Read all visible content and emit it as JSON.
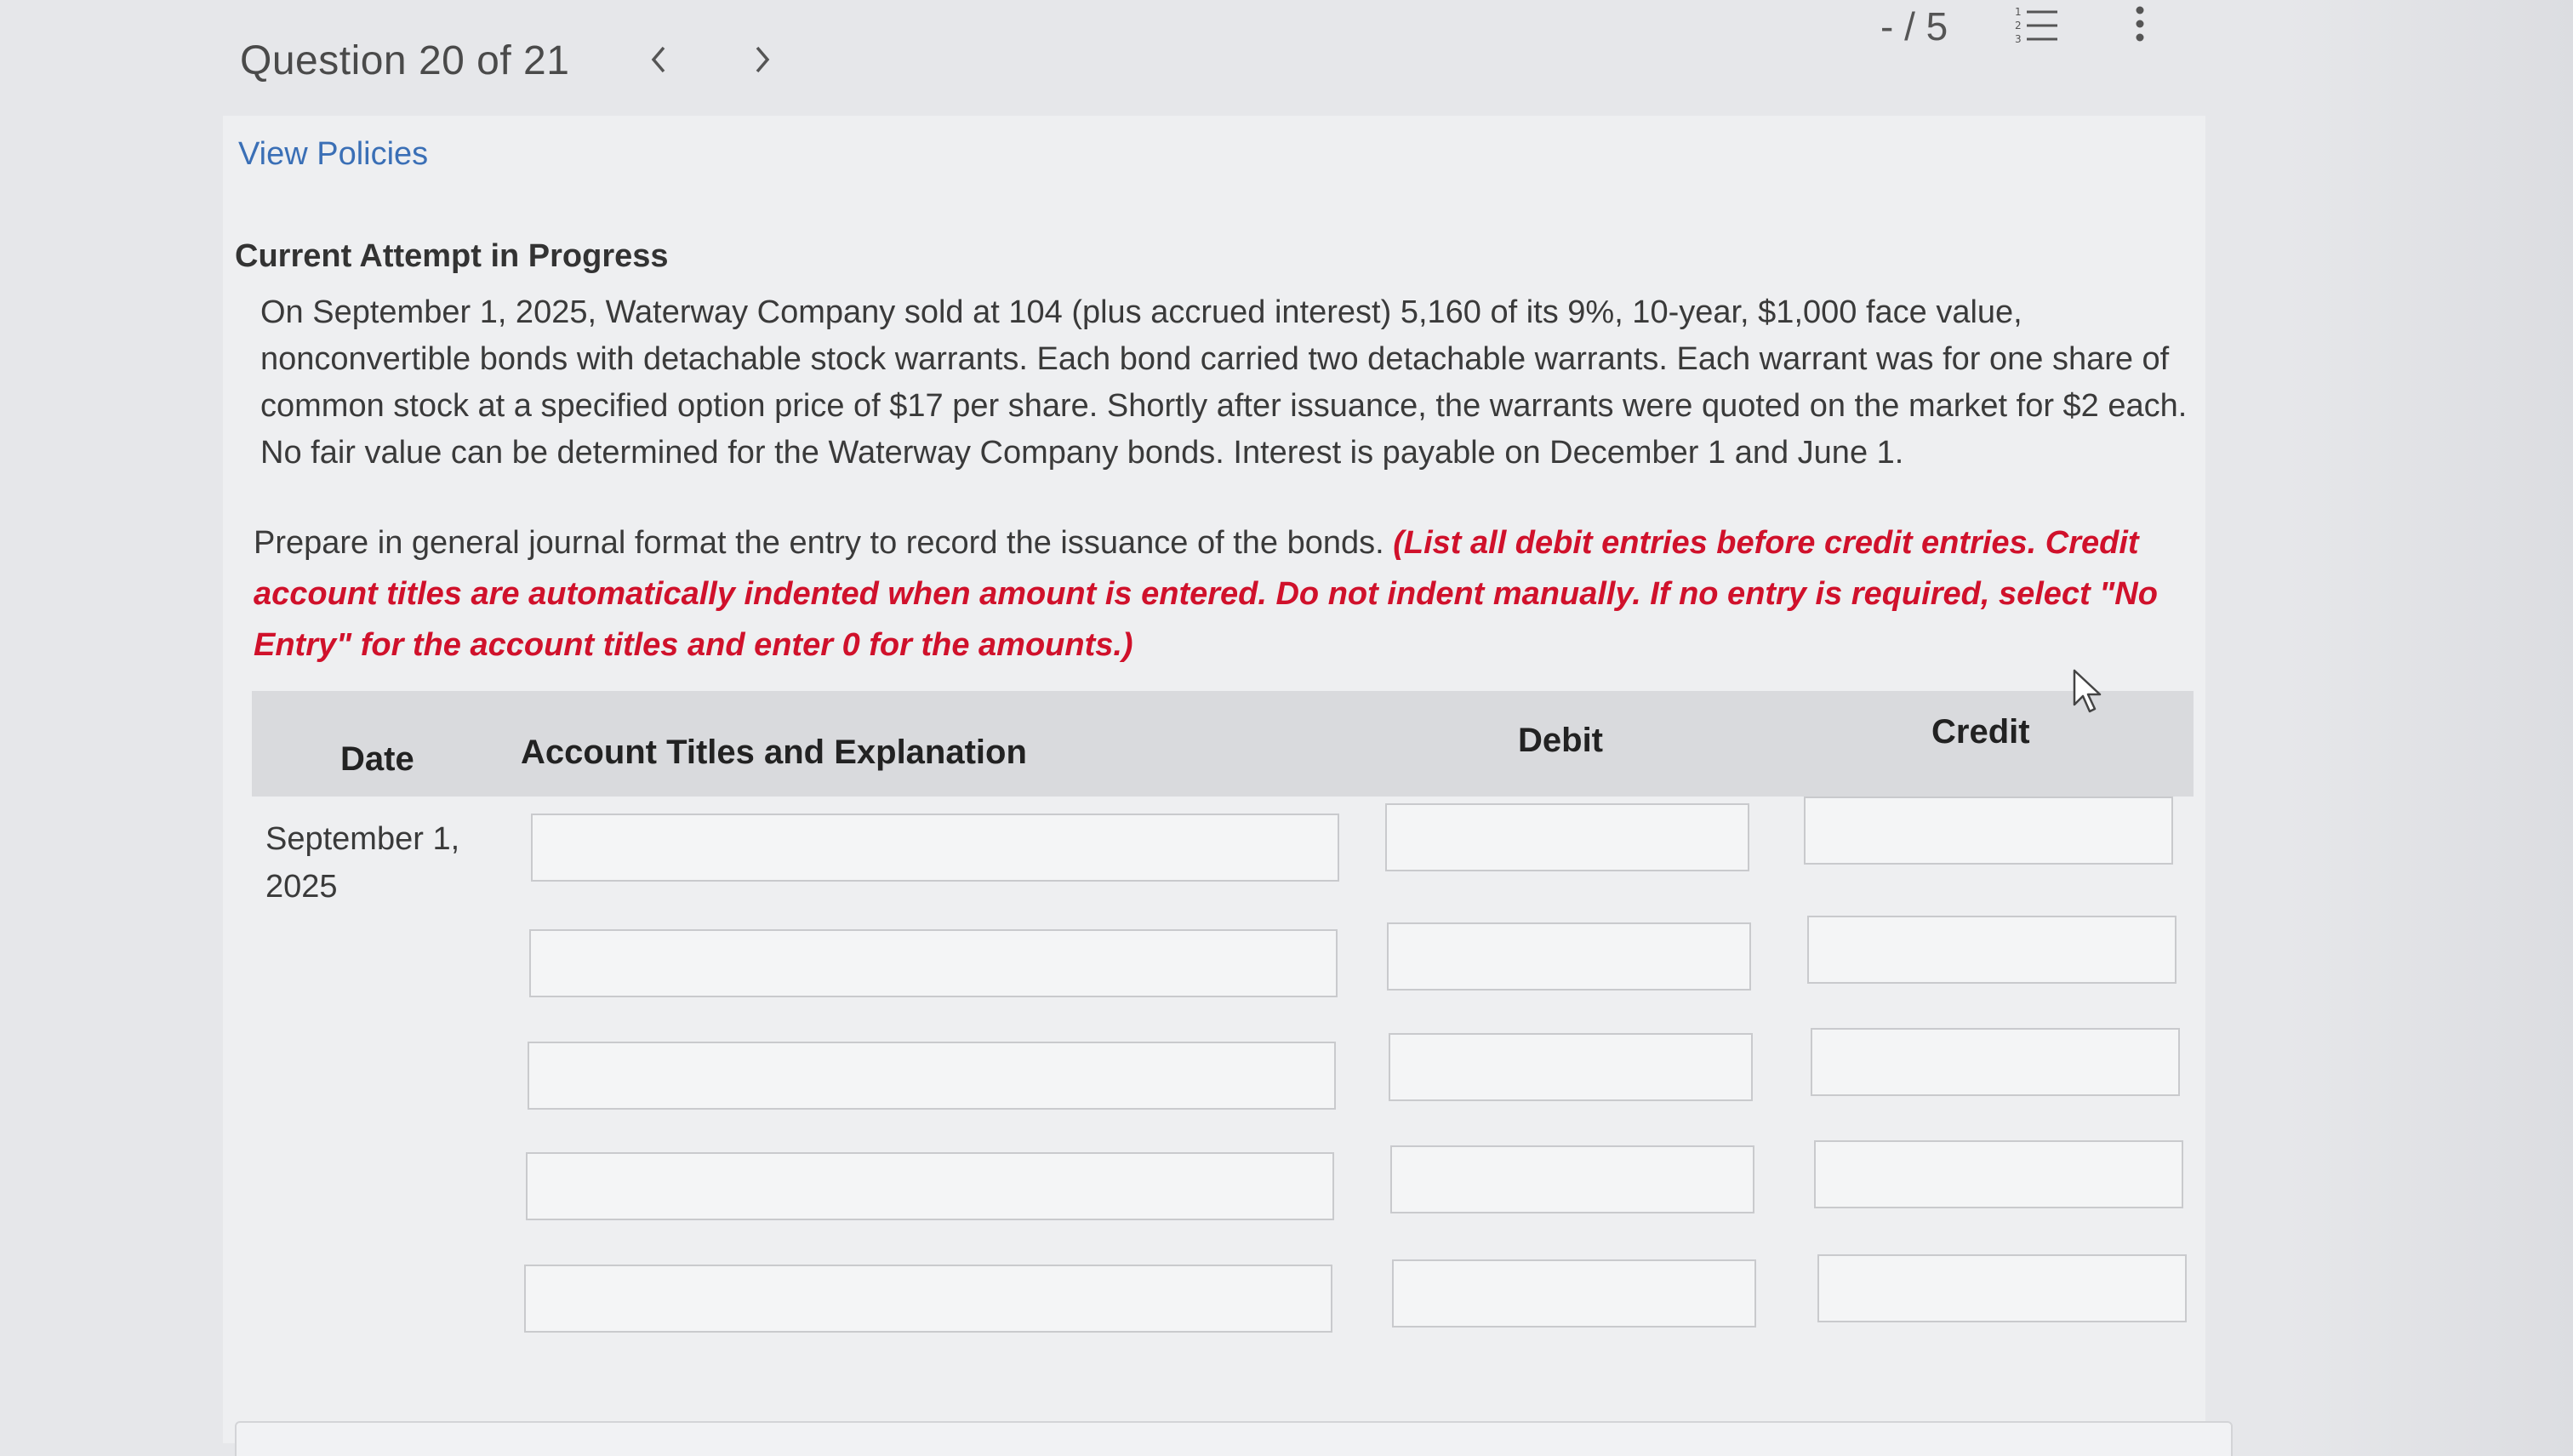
{
  "header": {
    "question_label": "Question 20 of 21",
    "prev_glyph": "<",
    "next_glyph": ">",
    "score": "- / 5",
    "view_policies": "View Policies"
  },
  "attempt_status": "Current Attempt in Progress",
  "problem_text": "On September 1, 2025, Waterway Company sold at 104 (plus accrued interest) 5,160 of its 9%, 10-year, $1,000 face value, nonconvertible bonds with detachable stock warrants. Each bond carried two detachable warrants. Each warrant was for one share of common stock at a specified option price of $17 per share. Shortly after issuance, the warrants were quoted on the market for $2 each. No fair value can be determined for the Waterway Company bonds. Interest is payable on December 1 and June 1.",
  "instructions": {
    "plain": "Prepare in general journal format the entry to record the issuance of the bonds.",
    "emphasis": "(List all debit entries before credit entries. Credit account titles are automatically indented when amount is entered. Do not indent manually. If no entry is required, select \"No Entry\" for the account titles and enter 0 for the amounts.)"
  },
  "journal": {
    "columns": {
      "date": "Date",
      "account": "Account Titles and Explanation",
      "debit": "Debit",
      "credit": "Credit"
    },
    "date_line1": "September 1,",
    "date_line2": "2025",
    "rows": [
      {
        "account": "",
        "debit": "",
        "credit": ""
      },
      {
        "account": "",
        "debit": "",
        "credit": ""
      },
      {
        "account": "",
        "debit": "",
        "credit": ""
      },
      {
        "account": "",
        "debit": "",
        "credit": ""
      },
      {
        "account": "",
        "debit": "",
        "credit": ""
      }
    ]
  },
  "colors": {
    "link": "#3a6fb6",
    "emphasis_red": "#d0112b",
    "table_header_bg": "#d9dadd"
  },
  "icons": [
    "chevron-left-icon",
    "chevron-right-icon",
    "numbered-list-icon",
    "more-vertical-icon",
    "mouse-cursor-icon"
  ]
}
